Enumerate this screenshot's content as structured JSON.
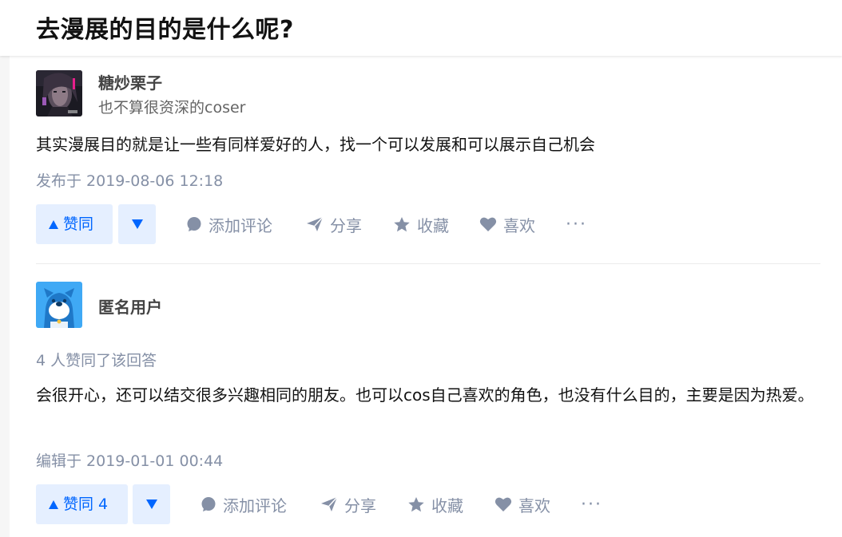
{
  "question": {
    "title": "去漫展的目的是什么呢?"
  },
  "answers": [
    {
      "author": {
        "name": "糖炒栗子",
        "bio": "也不算很资深的coser"
      },
      "voters_text": "",
      "content": "其实漫展目的就是让一些有同样爱好的人，找一个可以发展和可以展示自己机会",
      "time": "发布于 2019-08-06 12:18",
      "actions": {
        "vote_up": "赞同",
        "comment": "添加评论",
        "share": "分享",
        "collect": "收藏",
        "like": "喜欢",
        "more": "···"
      }
    },
    {
      "author": {
        "name": "匿名用户",
        "bio": ""
      },
      "voters_text": "4 人赞同了该回答",
      "content": "会很开心，还可以结交很多兴趣相同的朋友。也可以cos自己喜欢的角色，也没有什么目的，主要是因为热爱。",
      "time": "编辑于 2019-01-01 00:44",
      "actions": {
        "vote_up": "赞同 4",
        "comment": "添加评论",
        "share": "分享",
        "collect": "收藏",
        "like": "喜欢",
        "more": "···"
      }
    }
  ],
  "colors": {
    "accent": "#0066ff",
    "accent_bg": "#e5efff",
    "meta": "#8590a6"
  }
}
